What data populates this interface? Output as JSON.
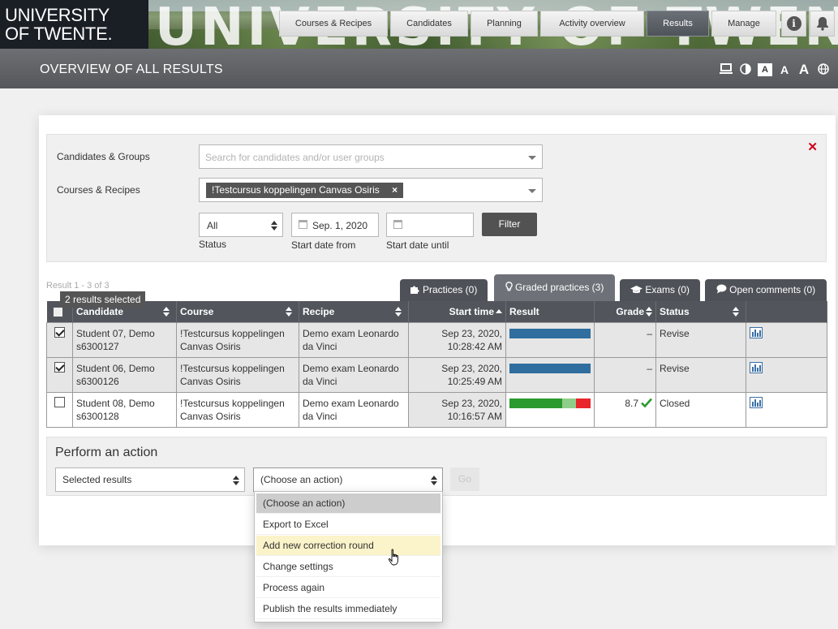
{
  "header": {
    "logo_line1": "UNIVERSITY",
    "logo_line2": "OF TWENTE.",
    "banner_text": "UNIVERSITY OF TWENTE",
    "nav": [
      {
        "label": "Courses & Recipes",
        "active": false
      },
      {
        "label": "Candidates",
        "active": false
      },
      {
        "label": "Planning",
        "active": false
      },
      {
        "label": "Activity overview",
        "active": false
      },
      {
        "label": "Results",
        "active": true
      },
      {
        "label": "Manage",
        "active": false
      }
    ],
    "info_glyph": "i",
    "icons": [
      "info-icon",
      "bell-icon"
    ]
  },
  "titlebar": {
    "title": "OVERVIEW OF ALL RESULTS",
    "a11y": [
      "laptop-icon",
      "contrast-icon",
      "font-small-icon",
      "font-medium-icon",
      "font-large-icon",
      "globe-icon"
    ],
    "font_glyph": "A"
  },
  "filters": {
    "candidates_label": "Candidates & Groups",
    "candidates_placeholder": "Search for candidates and/or user groups",
    "courses_label": "Courses & Recipes",
    "course_tag": "!Testcursus koppelingen Canvas Osiris",
    "tag_remove": "×",
    "status_value": "All",
    "status_label": "Status",
    "start_from_value": "Sep. 1, 2020",
    "start_from_label": "Start date from",
    "start_until_value": "",
    "start_until_label": "Start date until",
    "filter_button": "Filter",
    "close_glyph": "✕"
  },
  "tabs": [
    {
      "label": "Practices (0)",
      "icon": "puzzle-icon"
    },
    {
      "label": "Graded practices (3)",
      "icon": "lightbulb-icon",
      "active": true
    },
    {
      "label": "Exams (0)",
      "icon": "graduation-cap-icon"
    },
    {
      "label": "Open comments (0)",
      "icon": "comment-icon"
    }
  ],
  "result_count": "Result 1 - 3 of 3",
  "selected_tooltip": "2 results selected",
  "table": {
    "headers": [
      "Candidate",
      "Course",
      "Recipe",
      "Start time",
      "Result",
      "Grade",
      "Status"
    ],
    "rows": [
      {
        "checked": true,
        "candidate": "Student 07, Demo",
        "candidate_id": "s6300127",
        "course": "!Testcursus koppelingen Canvas Osiris",
        "recipe": "Demo exam Leonardo da Vinci",
        "date": "Sep 23, 2020,",
        "time": "10:28:42 AM",
        "grade": "–",
        "status": "Revise",
        "bar": [
          {
            "share": 1,
            "color": "#2f6e9e"
          }
        ]
      },
      {
        "checked": true,
        "candidate": "Student 06, Demo",
        "candidate_id": "s6300126",
        "course": "!Testcursus koppelingen Canvas Osiris",
        "recipe": "Demo exam Leonardo da Vinci",
        "date": "Sep 23, 2020,",
        "time": "10:25:49 AM",
        "grade": "–",
        "status": "Revise",
        "bar": [
          {
            "share": 1,
            "color": "#2f6e9e"
          }
        ]
      },
      {
        "checked": false,
        "candidate": "Student 08, Demo",
        "candidate_id": "s6300128",
        "course": "!Testcursus koppelingen Canvas Osiris",
        "recipe": "Demo exam Leonardo da Vinci",
        "date": "Sep 23, 2020,",
        "time": "10:16:57 AM",
        "grade": "8.7",
        "grade_pass": true,
        "status": "Closed",
        "bar": [
          {
            "share": 0.65,
            "color": "#2a9a2e"
          },
          {
            "share": 0.17,
            "color": "#8fce8a"
          },
          {
            "share": 0.18,
            "color": "#e8262b"
          }
        ]
      }
    ]
  },
  "action": {
    "title": "Perform an action",
    "scope_value": "Selected results",
    "action_value": "(Choose an action)",
    "go_label": "Go",
    "menu": [
      {
        "label": "(Choose an action)",
        "state": "current"
      },
      {
        "label": "Export to Excel",
        "state": ""
      },
      {
        "label": "Add new correction round",
        "state": "hover"
      },
      {
        "label": "Change settings",
        "state": ""
      },
      {
        "label": "Process again",
        "state": ""
      },
      {
        "label": "Publish the results immediately",
        "state": ""
      }
    ]
  }
}
